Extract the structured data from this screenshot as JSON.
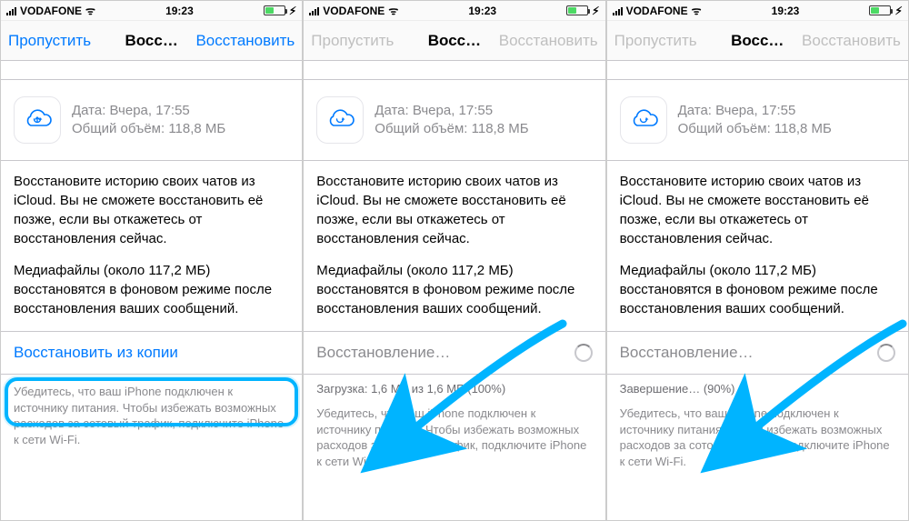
{
  "statusbar": {
    "carrier": "VODAFONE",
    "time": "19:23",
    "wifi_glyph": "ᯤ",
    "charging_glyph": "⚡︎"
  },
  "nav": {
    "skip": "Пропустить",
    "title_truncated": "Восс…",
    "restore": "Восстановить"
  },
  "backup": {
    "date_label": "Дата: Вчера, 17:55",
    "size_label": "Общий объём: 118,8 МБ"
  },
  "body": {
    "p1": "Восстановите историю своих чатов из iCloud. Вы не сможете восстановить её позже, если вы откажетесь от восстановления сейчас.",
    "p2": "Медиафайлы (около 117,2 МБ) восстановятся в фоновом режиме после восстановления ваших сообщений."
  },
  "footnote": "Убедитесь, что ваш iPhone подключен к источнику питания. Чтобы избежать возможных расходов за сотовый трафик, подключите iPhone к сети Wi-Fi.",
  "screens": [
    {
      "restore_label": "Восстановить из копии",
      "mode": "link",
      "progress_line": "",
      "nav_dimmed": false,
      "highlight": true,
      "arrow": false
    },
    {
      "restore_label": "Восстановление…",
      "mode": "progress",
      "progress_line": "Загрузка: 1,6 МБ из 1,6 МБ (100%)",
      "nav_dimmed": true,
      "highlight": false,
      "arrow": true
    },
    {
      "restore_label": "Восстановление…",
      "mode": "progress",
      "progress_line": "Завершение… (90%)",
      "nav_dimmed": true,
      "highlight": false,
      "arrow": true
    }
  ],
  "colors": {
    "ios_blue": "#007aff",
    "annotation_blue": "#00b4ff"
  }
}
